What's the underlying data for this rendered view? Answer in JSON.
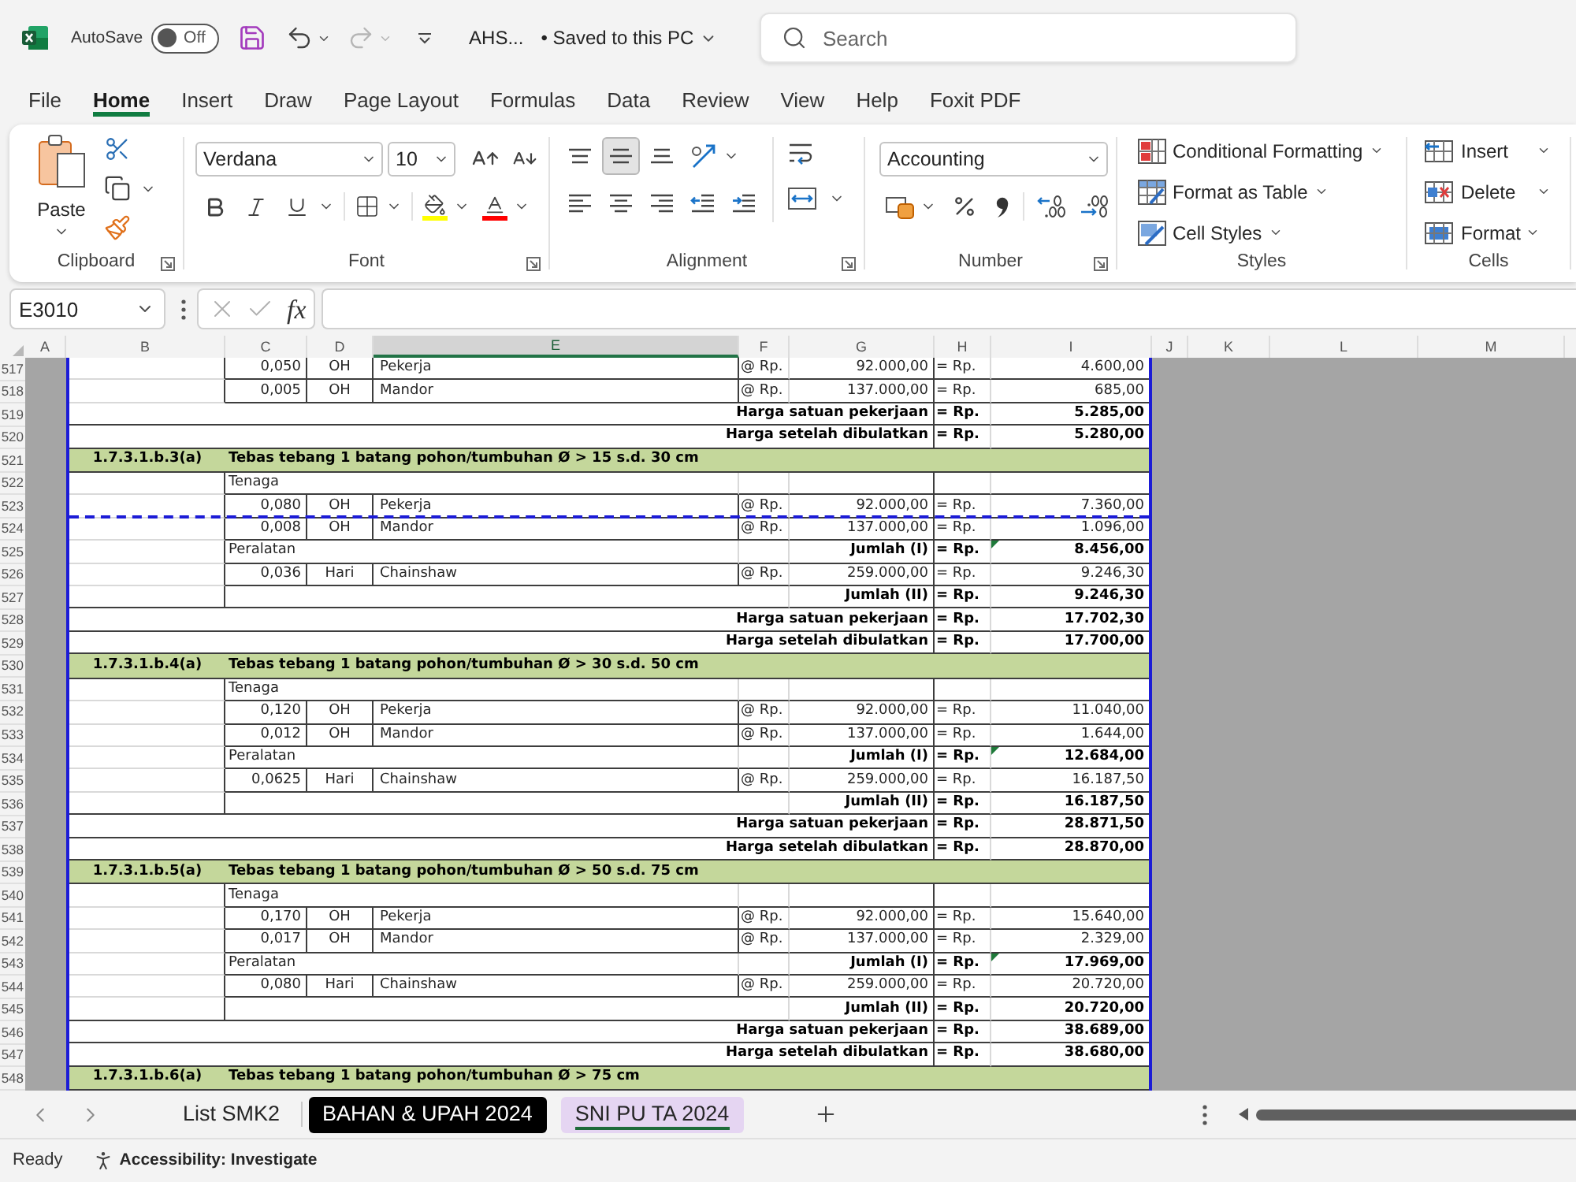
{
  "title_bar": {
    "autosave": {
      "label": "AutoSave",
      "state_text": "Off",
      "on": false
    },
    "redo_disabled": true,
    "file_name": "AHS...",
    "save_status": "• Saved to this PC",
    "search": {
      "placeholder": "Search"
    }
  },
  "menu_tabs": [
    {
      "label": "File",
      "selected": false
    },
    {
      "label": "Home",
      "selected": true
    },
    {
      "label": "Insert",
      "selected": false
    },
    {
      "label": "Draw",
      "selected": false
    },
    {
      "label": "Page Layout",
      "selected": false
    },
    {
      "label": "Formulas",
      "selected": false
    },
    {
      "label": "Data",
      "selected": false
    },
    {
      "label": "Review",
      "selected": false
    },
    {
      "label": "View",
      "selected": false
    },
    {
      "label": "Help",
      "selected": false
    },
    {
      "label": "Foxit PDF",
      "selected": false
    }
  ],
  "ribbon": {
    "clipboard": {
      "paste": "Paste",
      "label": "Clipboard"
    },
    "font": {
      "font_name": "Verdana",
      "font_size": "10",
      "label": "Font"
    },
    "alignment": {
      "vertical": [
        {
          "kind": "top",
          "selected": false
        },
        {
          "kind": "middle",
          "selected": true
        },
        {
          "kind": "bottom",
          "selected": false
        }
      ],
      "label": "Alignment"
    },
    "number": {
      "format": "Accounting",
      "label": "Number"
    },
    "styles": {
      "items": [
        {
          "kind": "conditional",
          "label": "Conditional Formatting"
        },
        {
          "kind": "table",
          "label": "Format as Table"
        },
        {
          "kind": "cell_styles",
          "label": "Cell Styles"
        }
      ],
      "label": "Styles"
    },
    "cells": {
      "items": [
        {
          "kind": "insert",
          "label": "Insert"
        },
        {
          "kind": "delete",
          "label": "Delete"
        },
        {
          "kind": "format",
          "label": "Format"
        }
      ],
      "label": "Cells"
    }
  },
  "formula_bar": {
    "name_box": "E3010",
    "edit_buttons_disabled": true,
    "function_label": "fx"
  },
  "columns": [
    {
      "label": "A",
      "selected": false
    },
    {
      "label": "B",
      "selected": false
    },
    {
      "label": "C",
      "selected": false
    },
    {
      "label": "D",
      "selected": false
    },
    {
      "label": "E",
      "selected": true
    },
    {
      "label": "F",
      "selected": false
    },
    {
      "label": "G",
      "selected": false
    },
    {
      "label": "H",
      "selected": false
    },
    {
      "label": "I",
      "selected": false
    },
    {
      "label": "J",
      "selected": false
    },
    {
      "label": "K",
      "selected": false
    },
    {
      "label": "L",
      "selected": false
    },
    {
      "label": "M",
      "selected": false
    }
  ],
  "rows": [
    {
      "row": "517",
      "kind": "item",
      "coef": "0,050",
      "unit": "OH",
      "name": "Pekerja",
      "at": "@ Rp.",
      "price": "92.000,00",
      "eq": "= Rp.",
      "total": "4.600,00"
    },
    {
      "row": "518",
      "kind": "item",
      "coef": "0,005",
      "unit": "OH",
      "name": "Mandor",
      "at": "@ Rp.",
      "price": "137.000,00",
      "eq": "= Rp.",
      "total": "685,00"
    },
    {
      "row": "519",
      "kind": "summary",
      "label": "Harga satuan pekerjaan",
      "eq": "= Rp.",
      "total": "5.285,00"
    },
    {
      "row": "520",
      "kind": "summary",
      "label": "Harga setelah dibulatkan",
      "eq": "= Rp.",
      "total": "5.280,00"
    },
    {
      "row": "521",
      "kind": "section",
      "code": "1.7.3.1.b.3(a)",
      "title": "Tebas tebang 1 batang pohon/tumbuhan Ø > 15 s.d. 30 cm"
    },
    {
      "row": "522",
      "kind": "group",
      "label": "Tenaga"
    },
    {
      "row": "523",
      "kind": "item",
      "coef": "0,080",
      "unit": "OH",
      "name": "Pekerja",
      "at": "@ Rp.",
      "price": "92.000,00",
      "eq": "= Rp.",
      "total": "7.360,00"
    },
    {
      "row": "524",
      "kind": "item",
      "coef": "0,008",
      "unit": "OH",
      "name": "Mandor",
      "at": "@ Rp.",
      "price": "137.000,00",
      "eq": "= Rp.",
      "total": "1.096,00",
      "page_break": true
    },
    {
      "row": "525",
      "kind": "group",
      "label": "Peralatan",
      "sum_label": "Jumlah (I)",
      "eq": "= Rp.",
      "total": "8.456,00",
      "flagged": true
    },
    {
      "row": "526",
      "kind": "item",
      "coef": "0,036",
      "unit": "Hari",
      "name": "Chainshaw",
      "at": "@ Rp.",
      "price": "259.000,00",
      "eq": "= Rp.",
      "total": "9.246,30"
    },
    {
      "row": "527",
      "kind": "total",
      "sum_label": "Jumlah (II)",
      "eq": "= Rp.",
      "total": "9.246,30"
    },
    {
      "row": "528",
      "kind": "summary",
      "label": "Harga satuan pekerjaan",
      "eq": "= Rp.",
      "total": "17.702,30"
    },
    {
      "row": "529",
      "kind": "summary",
      "label": "Harga setelah dibulatkan",
      "eq": "= Rp.",
      "total": "17.700,00"
    },
    {
      "row": "530",
      "kind": "section",
      "code": "1.7.3.1.b.4(a)",
      "title": "Tebas tebang 1 batang pohon/tumbuhan Ø > 30 s.d. 50 cm"
    },
    {
      "row": "531",
      "kind": "group",
      "label": "Tenaga"
    },
    {
      "row": "532",
      "kind": "item",
      "coef": "0,120",
      "unit": "OH",
      "name": "Pekerja",
      "at": "@ Rp.",
      "price": "92.000,00",
      "eq": "= Rp.",
      "total": "11.040,00"
    },
    {
      "row": "533",
      "kind": "item",
      "coef": "0,012",
      "unit": "OH",
      "name": "Mandor",
      "at": "@ Rp.",
      "price": "137.000,00",
      "eq": "= Rp.",
      "total": "1.644,00"
    },
    {
      "row": "534",
      "kind": "group",
      "label": "Peralatan",
      "sum_label": "Jumlah (I)",
      "eq": "= Rp.",
      "total": "12.684,00",
      "flagged": true
    },
    {
      "row": "535",
      "kind": "item",
      "coef": "0,0625",
      "unit": "Hari",
      "name": "Chainshaw",
      "at": "@ Rp.",
      "price": "259.000,00",
      "eq": "= Rp.",
      "total": "16.187,50"
    },
    {
      "row": "536",
      "kind": "total",
      "sum_label": "Jumlah (II)",
      "eq": "= Rp.",
      "total": "16.187,50"
    },
    {
      "row": "537",
      "kind": "summary",
      "label": "Harga satuan pekerjaan",
      "eq": "= Rp.",
      "total": "28.871,50"
    },
    {
      "row": "538",
      "kind": "summary",
      "label": "Harga setelah dibulatkan",
      "eq": "= Rp.",
      "total": "28.870,00"
    },
    {
      "row": "539",
      "kind": "section",
      "code": "1.7.3.1.b.5(a)",
      "title": "Tebas tebang 1 batang pohon/tumbuhan Ø > 50 s.d. 75 cm"
    },
    {
      "row": "540",
      "kind": "group",
      "label": "Tenaga"
    },
    {
      "row": "541",
      "kind": "item",
      "coef": "0,170",
      "unit": "OH",
      "name": "Pekerja",
      "at": "@ Rp.",
      "price": "92.000,00",
      "eq": "= Rp.",
      "total": "15.640,00"
    },
    {
      "row": "542",
      "kind": "item",
      "coef": "0,017",
      "unit": "OH",
      "name": "Mandor",
      "at": "@ Rp.",
      "price": "137.000,00",
      "eq": "= Rp.",
      "total": "2.329,00"
    },
    {
      "row": "543",
      "kind": "group",
      "label": "Peralatan",
      "sum_label": "Jumlah (I)",
      "eq": "= Rp.",
      "total": "17.969,00",
      "flagged": true
    },
    {
      "row": "544",
      "kind": "item",
      "coef": "0,080",
      "unit": "Hari",
      "name": "Chainshaw",
      "at": "@ Rp.",
      "price": "259.000,00",
      "eq": "= Rp.",
      "total": "20.720,00"
    },
    {
      "row": "545",
      "kind": "total",
      "sum_label": "Jumlah (II)",
      "eq": "= Rp.",
      "total": "20.720,00"
    },
    {
      "row": "546",
      "kind": "summary",
      "label": "Harga satuan pekerjaan",
      "eq": "= Rp.",
      "total": "38.689,00"
    },
    {
      "row": "547",
      "kind": "summary",
      "label": "Harga setelah dibulatkan",
      "eq": "= Rp.",
      "total": "38.680,00"
    },
    {
      "row": "548",
      "kind": "section",
      "code": "1.7.3.1.b.6(a)",
      "title": "Tebas tebang 1 batang pohon/tumbuhan Ø > 75 cm"
    }
  ],
  "sheet_tabs": [
    {
      "label": "List SMK2",
      "selected": false
    },
    {
      "label": "BAHAN & UPAH 2024",
      "selected": false,
      "color": "#000000"
    },
    {
      "label": "SNI PU TA 2024",
      "selected": true,
      "color": "#e5d5f2"
    }
  ],
  "status_bar": {
    "mode": "Ready",
    "accessibility": "Accessibility: Investigate"
  }
}
